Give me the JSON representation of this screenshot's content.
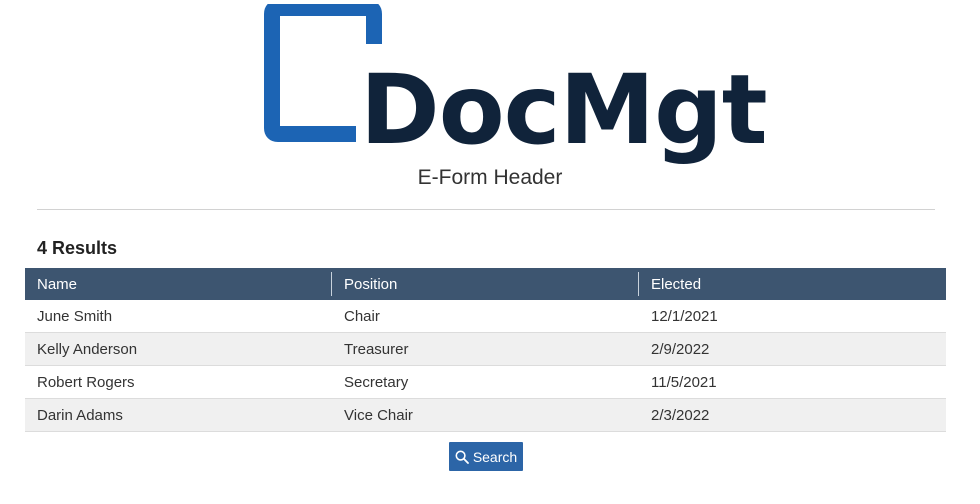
{
  "logo": {
    "text": "DocMgt",
    "mark_color": "#1c64b4",
    "text_color": "#10233a"
  },
  "header": {
    "title": "E-Form Header"
  },
  "results": {
    "count_label": "4 Results"
  },
  "table": {
    "columns": [
      "Name",
      "Position",
      "Elected"
    ],
    "rows": [
      {
        "name": "June Smith",
        "position": "Chair",
        "elected": "12/1/2021"
      },
      {
        "name": "Kelly Anderson",
        "position": "Treasurer",
        "elected": "2/9/2022"
      },
      {
        "name": "Robert Rogers",
        "position": "Secretary",
        "elected": "11/5/2021"
      },
      {
        "name": "Darin Adams",
        "position": "Vice Chair",
        "elected": "2/3/2022"
      }
    ],
    "header_color": "#3d5570"
  },
  "search_button": {
    "label": "Search",
    "icon": "search-icon",
    "color": "#2c65a7"
  }
}
